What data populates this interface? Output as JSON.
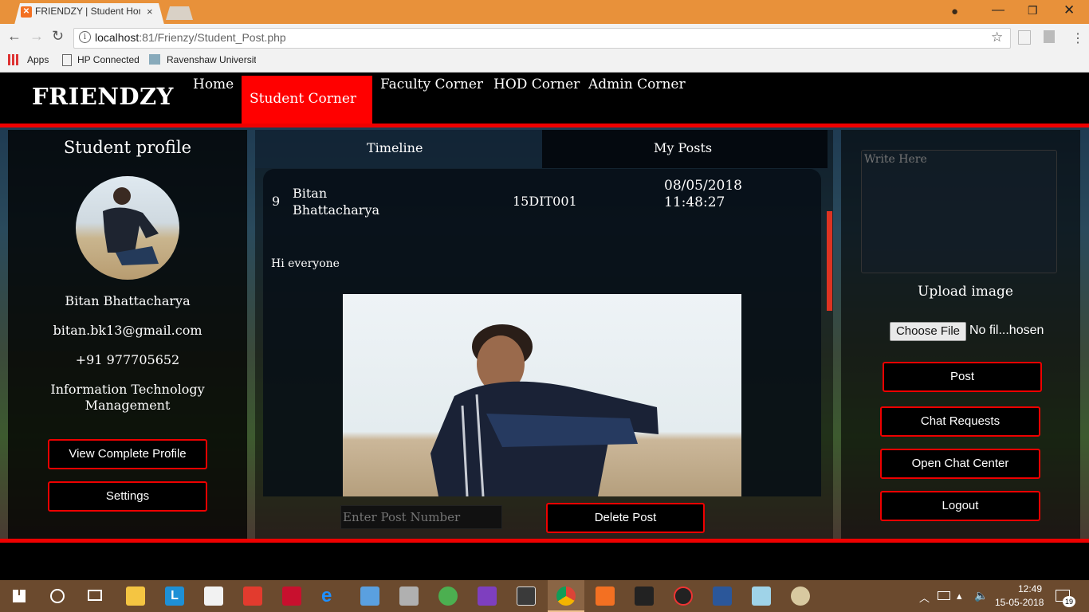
{
  "browser": {
    "tab_title": "FRIENDZY | Student Hom",
    "tab_close": "×",
    "url_host": "localhost",
    "url_port": ":81",
    "url_path": "/Frienzy/Student_Post.php",
    "bookmarks": [
      "Apps",
      "HP Connected",
      "Ravenshaw University"
    ]
  },
  "site": {
    "brand": "FRIENDZY",
    "nav": [
      "Home",
      "Student Corner",
      "Faculty Corner",
      "HOD Corner",
      "Admin Corner"
    ],
    "active_nav": "Student Corner"
  },
  "profile": {
    "heading": "Student profile",
    "name": "Bitan Bhattacharya",
    "email": "bitan.bk13@gmail.com",
    "phone": "+91 977705652",
    "department_line1": "Information Technology",
    "department_line2": "Management",
    "view_profile_button": "View Complete Profile",
    "settings_button": "Settings"
  },
  "posts": {
    "tabs": [
      "Timeline",
      "My Posts"
    ],
    "post": {
      "number": "9",
      "author_line1": "Bitan",
      "author_line2": "Bhattacharya",
      "roll": "15DIT001",
      "date": "08/05/2018",
      "time": "11:48:27",
      "text": "Hi everyone"
    },
    "delete_placeholder": "Enter Post Number",
    "delete_button": "Delete Post"
  },
  "composer": {
    "placeholder": "Write Here",
    "upload_label": "Upload image",
    "choose_file": "Choose File",
    "file_status": "No fil...hosen",
    "post_button": "Post",
    "chat_requests_button": "Chat Requests",
    "chat_center_button": "Open Chat Center",
    "logout_button": "Logout"
  },
  "taskbar": {
    "time": "12:49",
    "date": "15-05-2018",
    "notifications": "19"
  },
  "colors": {
    "accent_red": "#ff0000",
    "chrome_orange": "#e8913a",
    "taskbar_brown": "#6b4a2e"
  }
}
